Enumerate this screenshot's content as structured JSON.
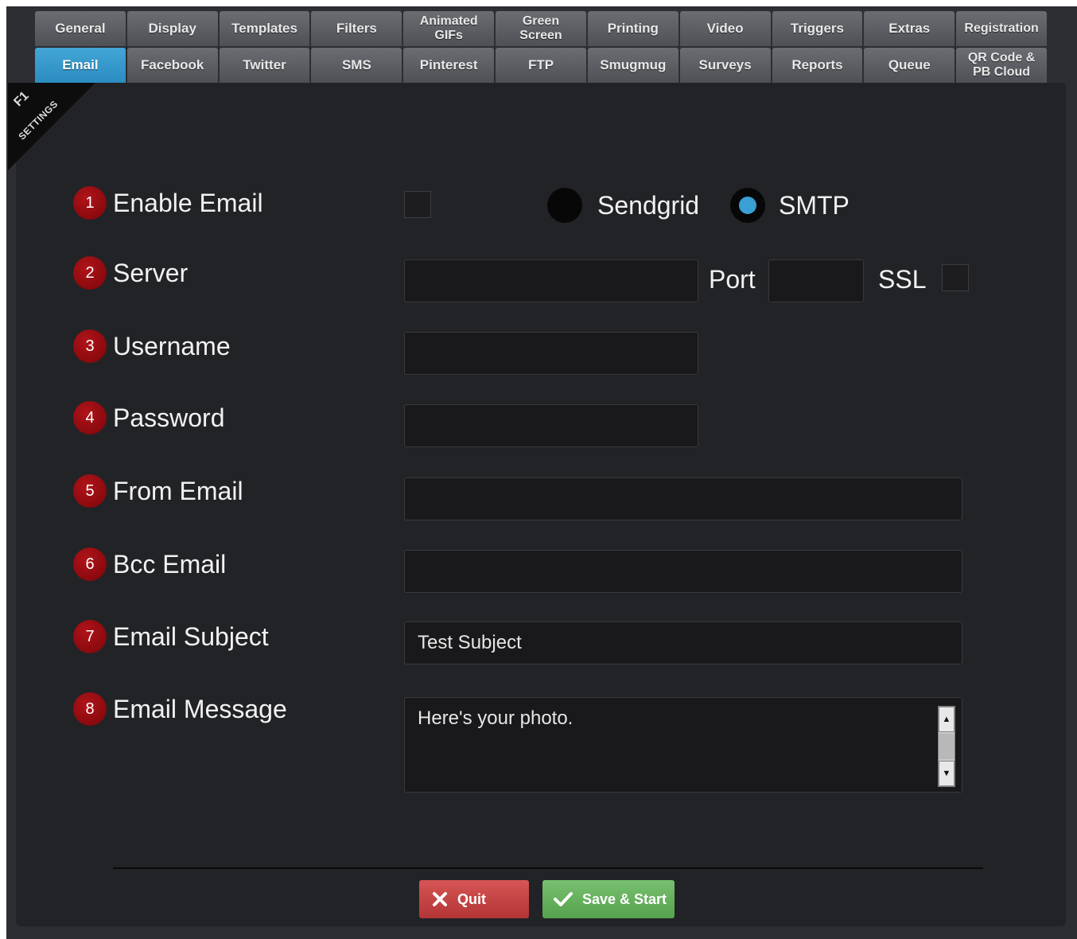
{
  "tabs_row1": [
    {
      "label": "General"
    },
    {
      "label": "Display"
    },
    {
      "label": "Templates"
    },
    {
      "label": "Filters"
    },
    {
      "label": "Animated\nGIFs"
    },
    {
      "label": "Green\nScreen"
    },
    {
      "label": "Printing"
    },
    {
      "label": "Video"
    },
    {
      "label": "Triggers"
    },
    {
      "label": "Extras"
    },
    {
      "label": "Registration"
    }
  ],
  "tabs_row2": [
    {
      "label": "Email",
      "active": true
    },
    {
      "label": "Facebook"
    },
    {
      "label": "Twitter"
    },
    {
      "label": "SMS"
    },
    {
      "label": "Pinterest"
    },
    {
      "label": "FTP"
    },
    {
      "label": "Smugmug"
    },
    {
      "label": "Surveys"
    },
    {
      "label": "Reports"
    },
    {
      "label": "Queue"
    },
    {
      "label": "QR Code &\nPB Cloud"
    }
  ],
  "ribbon": {
    "key": "F1",
    "label": "SETTINGS"
  },
  "form": {
    "enable_email": {
      "num": "1",
      "label": "Enable Email",
      "checked": false
    },
    "provider": {
      "sendgrid_label": "Sendgrid",
      "smtp_label": "SMTP",
      "selected": "SMTP"
    },
    "server": {
      "num": "2",
      "label": "Server",
      "value": ""
    },
    "port": {
      "label": "Port",
      "value": ""
    },
    "ssl": {
      "label": "SSL",
      "checked": false
    },
    "username": {
      "num": "3",
      "label": "Username",
      "value": ""
    },
    "password": {
      "num": "4",
      "label": "Password",
      "value": ""
    },
    "from_email": {
      "num": "5",
      "label": "From Email",
      "value": ""
    },
    "bcc_email": {
      "num": "6",
      "label": "Bcc Email",
      "value": ""
    },
    "subject": {
      "num": "7",
      "label": "Email Subject",
      "value": "Test Subject"
    },
    "message": {
      "num": "8",
      "label": "Email Message",
      "value": "Here's your photo."
    }
  },
  "buttons": {
    "quit": "Quit",
    "save": "Save & Start"
  },
  "colors": {
    "active_tab": "#2b8cc0",
    "radio_selected": "#3a9fd3",
    "quit": "#c64444",
    "save": "#66b15e",
    "badge": "#9b0c10"
  }
}
